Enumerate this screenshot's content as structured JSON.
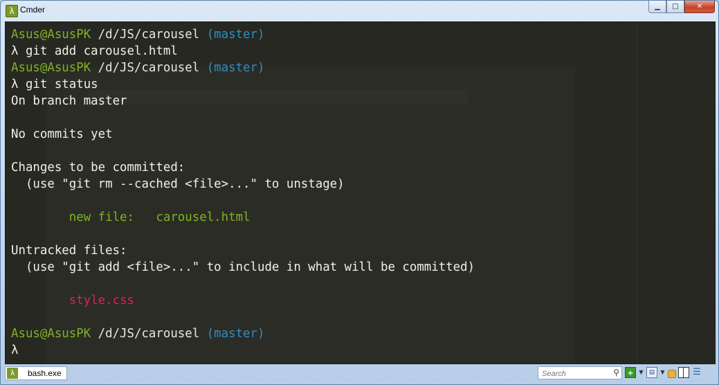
{
  "window": {
    "title": "Cmder",
    "app_icon": "λ",
    "buttons": {
      "minimize": "▁",
      "maximize": "□",
      "close": "✕"
    }
  },
  "console": {
    "lines": [
      {
        "parts": [
          {
            "text": "Asus@AsusPK",
            "color": "user"
          },
          {
            "text": " /d/JS/carousel ",
            "color": "path"
          },
          {
            "text": "(master)",
            "color": "branch"
          }
        ]
      },
      {
        "parts": [
          {
            "text": "λ git add carousel.html",
            "color": "plain"
          }
        ]
      },
      {
        "parts": [
          {
            "text": "Asus@AsusPK",
            "color": "user"
          },
          {
            "text": " /d/JS/carousel ",
            "color": "path"
          },
          {
            "text": "(master)",
            "color": "branch"
          }
        ]
      },
      {
        "parts": [
          {
            "text": "λ git status",
            "color": "plain"
          }
        ]
      },
      {
        "parts": [
          {
            "text": "On branch master",
            "color": "plain"
          }
        ]
      },
      {
        "parts": []
      },
      {
        "parts": [
          {
            "text": "No commits yet",
            "color": "plain"
          }
        ]
      },
      {
        "parts": []
      },
      {
        "parts": [
          {
            "text": "Changes to be committed:",
            "color": "plain"
          }
        ]
      },
      {
        "parts": [
          {
            "text": "  (use \"git rm --cached <file>...\" to unstage)",
            "color": "plain"
          }
        ]
      },
      {
        "parts": []
      },
      {
        "parts": [
          {
            "text": "        new file:   carousel.html",
            "color": "green"
          }
        ]
      },
      {
        "parts": []
      },
      {
        "parts": [
          {
            "text": "Untracked files:",
            "color": "plain"
          }
        ]
      },
      {
        "parts": [
          {
            "text": "  (use \"git add <file>...\" to include in what will be committed)",
            "color": "plain"
          }
        ]
      },
      {
        "parts": []
      },
      {
        "parts": [
          {
            "text": "        style.css",
            "color": "red"
          }
        ]
      },
      {
        "parts": []
      },
      {
        "parts": [
          {
            "text": "Asus@AsusPK",
            "color": "user"
          },
          {
            "text": " /d/JS/carousel ",
            "color": "path"
          },
          {
            "text": "(master)",
            "color": "branch"
          }
        ]
      },
      {
        "parts": [
          {
            "text": "λ",
            "color": "plain"
          }
        ]
      }
    ]
  },
  "statusbar": {
    "tab_label": "bash.exe",
    "tab_icon": "λ",
    "search_placeholder": "Search",
    "search_icon": "magnifier-icon"
  },
  "colors": {
    "user": "#7fb324",
    "branch": "#2e8fc2",
    "added": "#7fb324",
    "untracked": "#d7245a",
    "background": "#272822"
  }
}
